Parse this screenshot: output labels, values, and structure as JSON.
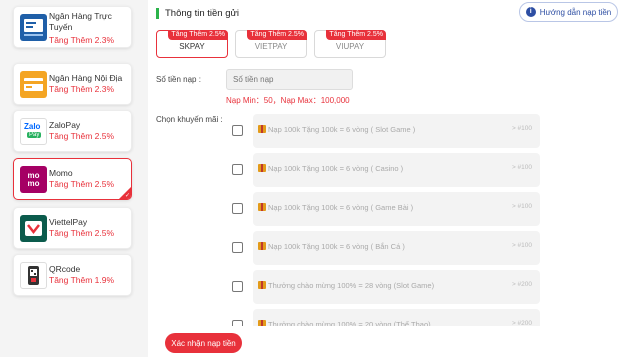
{
  "sidebar": {
    "items": [
      {
        "name": "Ngân Hàng Trực Tuyến",
        "bonus": "Tăng Thêm 2.3%",
        "icon": "online-bank-icon",
        "selected": false
      },
      {
        "name": "Ngân Hàng Nội Địa",
        "bonus": "Tăng Thêm 2.3%",
        "icon": "domestic-bank-icon",
        "selected": false
      },
      {
        "name": "ZaloPay",
        "bonus": "Tăng Thêm 2.5%",
        "icon": "zalopay-icon",
        "logo_text": "Zalo",
        "logo_sub": "Pay",
        "selected": false
      },
      {
        "name": "Momo",
        "bonus": "Tăng Thêm 2.5%",
        "icon": "momo-icon",
        "logo_text": "mo mo",
        "selected": true
      },
      {
        "name": "ViettelPay",
        "bonus": "Tăng Thêm 2.5%",
        "icon": "viettelpay-icon",
        "selected": false
      },
      {
        "name": "QRcode",
        "bonus": "Tăng Thêm 1.9%",
        "icon": "qrcode-icon",
        "selected": false
      }
    ]
  },
  "header": {
    "title": "Thông tin tiền gửi",
    "guide_label": "Hướng dẫn nạp tiền",
    "guide_icon_glyph": "i"
  },
  "channels": [
    {
      "badge": "Tăng Thêm 2.5%",
      "name": "SKPAY",
      "active": true
    },
    {
      "badge": "Tăng Thêm 2.5%",
      "name": "VIETPAY",
      "active": false
    },
    {
      "badge": "Tăng Thêm 2.5%",
      "name": "VIUPAY",
      "active": false
    }
  ],
  "amount": {
    "label": "Số tiền nạp :",
    "placeholder": "Số tiền nạp",
    "limits": "Nạp Min：50，Nạp Max：100,000"
  },
  "promotions": {
    "label": "Chọn khuyến mãi :",
    "items": [
      {
        "text": "Nạp 100k Tặng 100k = 6 vòng ( Slot Game )",
        "meta": "> #100"
      },
      {
        "text": "Nạp 100k Tặng 100k = 6 vòng ( Casino )",
        "meta": "> #100"
      },
      {
        "text": "Nạp 100k Tặng 100k = 6 vòng ( Game Bài )",
        "meta": "> #100"
      },
      {
        "text": "Nạp 100k Tặng 100k = 6 vòng ( Bắn Cá )",
        "meta": "> #100"
      },
      {
        "text": "Thưởng chào mừng 100% = 28 vòng (Slot Game)",
        "meta": "> #200"
      },
      {
        "text": "Thưởng chào mừng 100% = 20 vòng (Thể Thao)",
        "meta": "> #200"
      }
    ]
  },
  "confirm_label": "Xác nhận nạp tiền",
  "colors": {
    "accent": "#e8313b",
    "link": "#2d4ea3",
    "title_mark": "#2bb34a",
    "momo": "#a50064"
  }
}
